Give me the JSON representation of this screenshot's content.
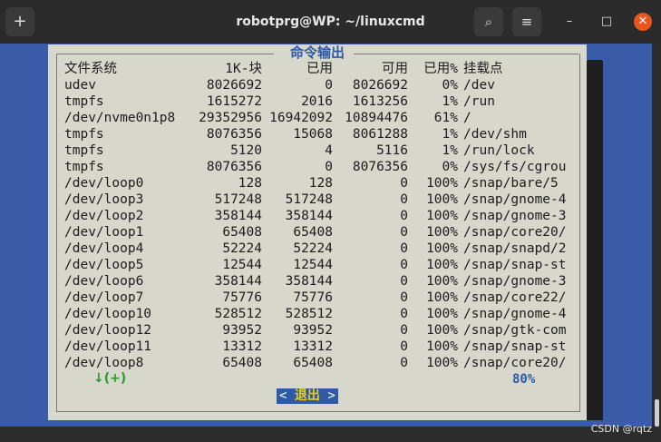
{
  "window": {
    "title": "robotprg@WP: ~/linuxcmd",
    "new_tab_icon": "+",
    "search_icon": "⌕",
    "menu_icon": "≡",
    "minimize": "–",
    "maximize": "□",
    "close": "✕"
  },
  "dialog": {
    "title": "命令输出",
    "headers": [
      "文件系统",
      "1K-块",
      "已用",
      "可用",
      "已用%",
      "挂载点"
    ],
    "rows": [
      [
        "udev",
        "8026692",
        "0",
        "8026692",
        "0%",
        "/dev"
      ],
      [
        "tmpfs",
        "1615272",
        "2016",
        "1613256",
        "1%",
        "/run"
      ],
      [
        "/dev/nvme0n1p8",
        "29352956",
        "16942092",
        "10894476",
        "61%",
        "/"
      ],
      [
        "tmpfs",
        "8076356",
        "15068",
        "8061288",
        "1%",
        "/dev/shm"
      ],
      [
        "tmpfs",
        "5120",
        "4",
        "5116",
        "1%",
        "/run/lock"
      ],
      [
        "tmpfs",
        "8076356",
        "0",
        "8076356",
        "0%",
        "/sys/fs/cgrou"
      ],
      [
        "/dev/loop0",
        "128",
        "128",
        "0",
        "100%",
        "/snap/bare/5"
      ],
      [
        "/dev/loop3",
        "517248",
        "517248",
        "0",
        "100%",
        "/snap/gnome-4"
      ],
      [
        "/dev/loop2",
        "358144",
        "358144",
        "0",
        "100%",
        "/snap/gnome-3"
      ],
      [
        "/dev/loop1",
        "65408",
        "65408",
        "0",
        "100%",
        "/snap/core20/"
      ],
      [
        "/dev/loop4",
        "52224",
        "52224",
        "0",
        "100%",
        "/snap/snapd/2"
      ],
      [
        "/dev/loop5",
        "12544",
        "12544",
        "0",
        "100%",
        "/snap/snap-st"
      ],
      [
        "/dev/loop6",
        "358144",
        "358144",
        "0",
        "100%",
        "/snap/gnome-3"
      ],
      [
        "/dev/loop7",
        "75776",
        "75776",
        "0",
        "100%",
        "/snap/core22/"
      ],
      [
        "/dev/loop10",
        "528512",
        "528512",
        "0",
        "100%",
        "/snap/gnome-4"
      ],
      [
        "/dev/loop12",
        "93952",
        "93952",
        "0",
        "100%",
        "/snap/gtk-com"
      ],
      [
        "/dev/loop11",
        "13312",
        "13312",
        "0",
        "100%",
        "/snap/snap-st"
      ],
      [
        "/dev/loop8",
        "65408",
        "65408",
        "0",
        "100%",
        "/snap/core20/"
      ]
    ],
    "scroll_indicator": "↓(+)",
    "scroll_percent": "80%",
    "exit_left": "<",
    "exit_label": "退出",
    "exit_right": ">"
  },
  "watermark": "CSDN @rqtz",
  "colors": {
    "background_blue": "#3a5ba7",
    "dialog_bg": "#d7d7cb",
    "title_blue": "#2e5aa6",
    "close_orange": "#e9541f",
    "indicator_green": "#2a9a2a",
    "exit_label_yellow": "#f0d000"
  }
}
